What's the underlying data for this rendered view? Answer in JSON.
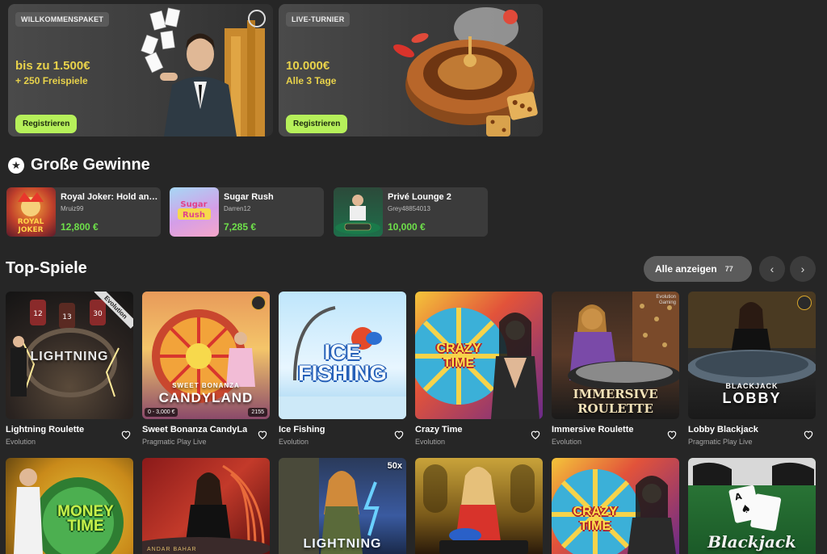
{
  "promos": [
    {
      "badge": "WILLKOMMENSPAKET",
      "line1": "bis zu 1.500€",
      "line2": "+ 250 Freispiele",
      "button": "Registrieren"
    },
    {
      "badge": "LIVE-TURNIER",
      "line1": "10.000€",
      "line2": "Alle 3 Tage",
      "button": "Registrieren"
    }
  ],
  "big_wins": {
    "title": "Große Gewinne",
    "items": [
      {
        "game": "Royal Joker: Hold an…",
        "user": "Mruiz99",
        "amount": "12,800 €"
      },
      {
        "game": "Sugar Rush",
        "user": "Darren12",
        "amount": "7,285 €"
      },
      {
        "game": "Privé Lounge 2",
        "user": "Grey48854013",
        "amount": "10,000 €"
      }
    ]
  },
  "top_games": {
    "title": "Top-Spiele",
    "show_all": "Alle anzeigen",
    "count": "77",
    "prev_icon": "‹",
    "next_icon": "›",
    "row1": [
      {
        "title": "Lightning Roulette",
        "provider": "Evolution",
        "tile_text": "LIGHTNING",
        "corner": "Evolution"
      },
      {
        "title": "Sweet Bonanza CandyLa…",
        "provider": "Pragmatic Play Live",
        "tile_text": "CANDYLAND",
        "tile_sub": "SWEET BONANZA",
        "bet_range": "0 - 3,000 €",
        "players": "2155"
      },
      {
        "title": "Ice Fishing",
        "provider": "Evolution",
        "tile_text": "ICE FISHING"
      },
      {
        "title": "Crazy Time",
        "provider": "Evolution",
        "tile_text": "CRAZY TIME"
      },
      {
        "title": "Immersive Roulette",
        "provider": "Evolution",
        "tile_text": "IMMERSIVE ROULETTE",
        "corner": "Evolution Gaming"
      },
      {
        "title": "Lobby Blackjack",
        "provider": "Pragmatic Play Live",
        "tile_text": "LOBBY",
        "tile_sub": "BLACKJACK"
      }
    ],
    "row2": [
      {
        "tile_text": "MONEY TIME"
      },
      {
        "tile_text": "ANDAR BAHAR"
      },
      {
        "tile_text": "LIGHTNING",
        "badge": "50x"
      },
      {
        "tile_text": ""
      },
      {
        "tile_text": "CRAZY TIME"
      },
      {
        "tile_text": "Blackjack"
      }
    ]
  },
  "colors": {
    "accent_green": "#b6f05a",
    "win_green": "#6ee04a",
    "promo_yellow": "#e8d24b",
    "background": "#262626"
  }
}
